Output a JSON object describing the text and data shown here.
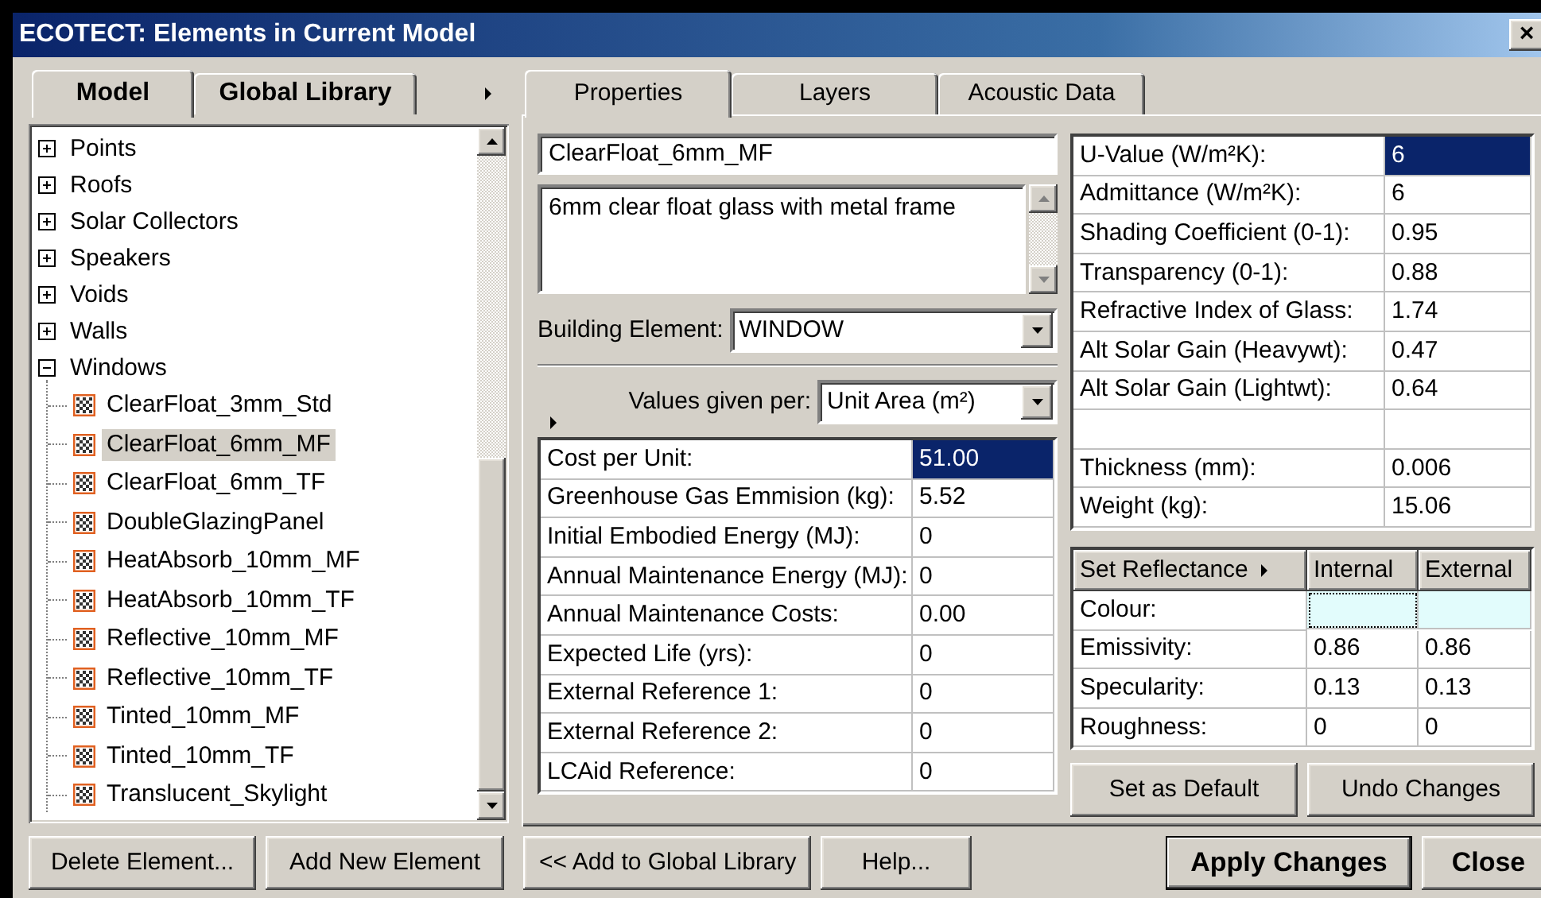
{
  "window": {
    "title": "ECOTECT: Elements in Current Model",
    "close_glyph": "×"
  },
  "left_tabs": [
    {
      "label": "Model",
      "selected": true
    },
    {
      "label": "Global Library",
      "selected": false
    }
  ],
  "tree": [
    {
      "label": "Points",
      "expanded": false,
      "selected": false
    },
    {
      "label": "Roofs",
      "expanded": false,
      "selected": false
    },
    {
      "label": "Solar Collectors",
      "expanded": false,
      "selected": false
    },
    {
      "label": "Speakers",
      "expanded": false,
      "selected": false
    },
    {
      "label": "Voids",
      "expanded": false,
      "selected": false
    },
    {
      "label": "Walls",
      "expanded": false,
      "selected": false
    },
    {
      "label": "Windows",
      "expanded": true,
      "selected": false,
      "children": [
        {
          "label": "ClearFloat_3mm_Std",
          "selected": false
        },
        {
          "label": "ClearFloat_6mm_MF",
          "selected": true
        },
        {
          "label": "ClearFloat_6mm_TF",
          "selected": false
        },
        {
          "label": "DoubleGlazingPanel",
          "selected": false
        },
        {
          "label": "HeatAbsorb_10mm_MF",
          "selected": false
        },
        {
          "label": "HeatAbsorb_10mm_TF",
          "selected": false
        },
        {
          "label": "Reflective_10mm_MF",
          "selected": false
        },
        {
          "label": "Reflective_10mm_TF",
          "selected": false
        },
        {
          "label": "Tinted_10mm_MF",
          "selected": false
        },
        {
          "label": "Tinted_10mm_TF",
          "selected": false
        },
        {
          "label": "Translucent_Skylight",
          "selected": false
        }
      ]
    }
  ],
  "left_buttons": [
    {
      "label": "Delete Element..."
    },
    {
      "label": "Add New Element"
    }
  ],
  "right_tabs": [
    {
      "label": "Properties",
      "selected": true
    },
    {
      "label": "Layers",
      "selected": false
    },
    {
      "label": "Acoustic Data",
      "selected": false
    }
  ],
  "properties": {
    "name": "ClearFloat_6mm_MF",
    "description": "6mm clear float glass with metal frame",
    "building_element": {
      "label": "Building Element:",
      "value": "WINDOW"
    },
    "values_per": {
      "label": "Values given per:",
      "value": "Unit Area (m²)"
    },
    "cost_rows": [
      {
        "label": "Cost per Unit:",
        "value": "51.00",
        "selected": true
      },
      {
        "label": "Greenhouse Gas Emmision (kg):",
        "value": "5.52",
        "selected": false
      },
      {
        "label": "Initial Embodied Energy (MJ):",
        "value": "0",
        "selected": false
      },
      {
        "label": "Annual Maintenance Energy (MJ):",
        "value": "0",
        "selected": false
      },
      {
        "label": "Annual Maintenance Costs:",
        "value": "0.00",
        "selected": false
      },
      {
        "label": "Expected Life (yrs):",
        "value": "0",
        "selected": false
      },
      {
        "label": "External Reference 1:",
        "value": "0",
        "selected": false
      },
      {
        "label": "External Reference 2:",
        "value": "0",
        "selected": false
      },
      {
        "label": "LCAid Reference:",
        "value": "0",
        "selected": false
      }
    ],
    "thermal_rows": [
      {
        "label": "U-Value (W/m²K):",
        "value": "6",
        "selected": true
      },
      {
        "label": "Admittance (W/m²K):",
        "value": "6",
        "selected": false
      },
      {
        "label": "Shading Coefficient (0-1):",
        "value": "0.95",
        "selected": false
      },
      {
        "label": "Transparency (0-1):",
        "value": "0.88",
        "selected": false
      },
      {
        "label": "Refractive Index of Glass:",
        "value": "1.74",
        "selected": false
      },
      {
        "label": "Alt Solar Gain (Heavywt):",
        "value": "0.47",
        "selected": false
      },
      {
        "label": "Alt Solar Gain (Lightwt):",
        "value": "0.64",
        "selected": false
      }
    ],
    "size_rows": [
      {
        "label": "Thickness (mm):",
        "value": "0.006",
        "selected": false
      },
      {
        "label": "Weight (kg):",
        "value": "15.06",
        "selected": false
      }
    ],
    "reflectance": {
      "button": {
        "label": "Set Reflectance"
      },
      "columns": [
        "Internal",
        "External"
      ],
      "rows": [
        {
          "kind": "color",
          "label": "Colour:",
          "cells": [
            {
              "color": "#e2fcfc",
              "focused": true
            },
            {
              "color": "#e2fcfc",
              "focused": false
            }
          ]
        },
        {
          "kind": "value",
          "label": "Emissivity:",
          "cells": [
            {
              "value": "0.86"
            },
            {
              "value": "0.86"
            }
          ]
        },
        {
          "kind": "value",
          "label": "Specularity:",
          "cells": [
            {
              "value": "0.13"
            },
            {
              "value": "0.13"
            }
          ]
        },
        {
          "kind": "value",
          "label": "Roughness:",
          "cells": [
            {
              "value": "0"
            },
            {
              "value": "0"
            }
          ]
        }
      ]
    },
    "panel_buttons": [
      {
        "label": "Set as Default"
      },
      {
        "label": "Undo Changes"
      }
    ]
  },
  "bottom_buttons": [
    {
      "label": "<< Add to Global Library"
    },
    {
      "label": "Help..."
    }
  ],
  "dialog_buttons": [
    {
      "label": "Apply Changes",
      "default": true
    },
    {
      "label": "Close",
      "default": false
    }
  ]
}
